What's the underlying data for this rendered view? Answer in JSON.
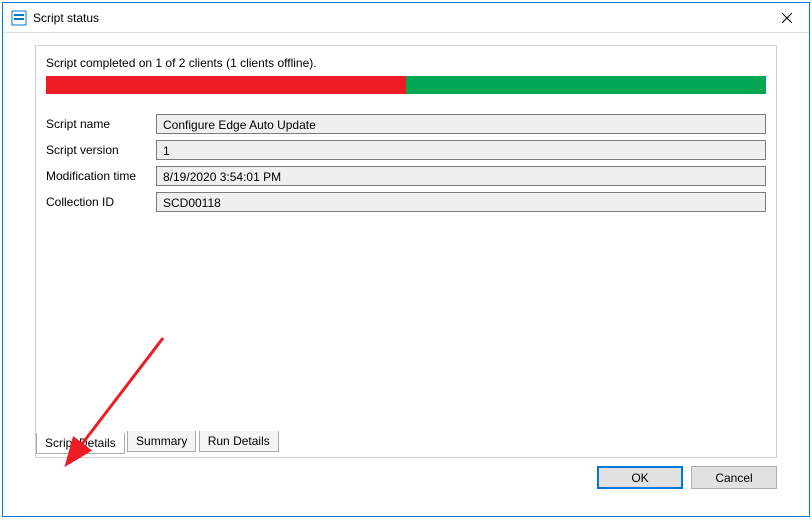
{
  "window": {
    "title": "Script status"
  },
  "status": {
    "text": "Script completed on 1 of 2 clients (1 clients offline).",
    "progress_red_pct": 50,
    "progress_green_pct": 50
  },
  "fields": {
    "script_name": {
      "label": "Script name",
      "value": "Configure Edge Auto Update"
    },
    "script_version": {
      "label": "Script version",
      "value": "1"
    },
    "modification_time": {
      "label": "Modification time",
      "value": "8/19/2020 3:54:01 PM"
    },
    "collection_id": {
      "label": "Collection ID",
      "value": "SCD00118"
    }
  },
  "tabs": {
    "script_details": "Script Details",
    "summary": "Summary",
    "run_details": "Run Details"
  },
  "buttons": {
    "ok": "OK",
    "cancel": "Cancel"
  }
}
